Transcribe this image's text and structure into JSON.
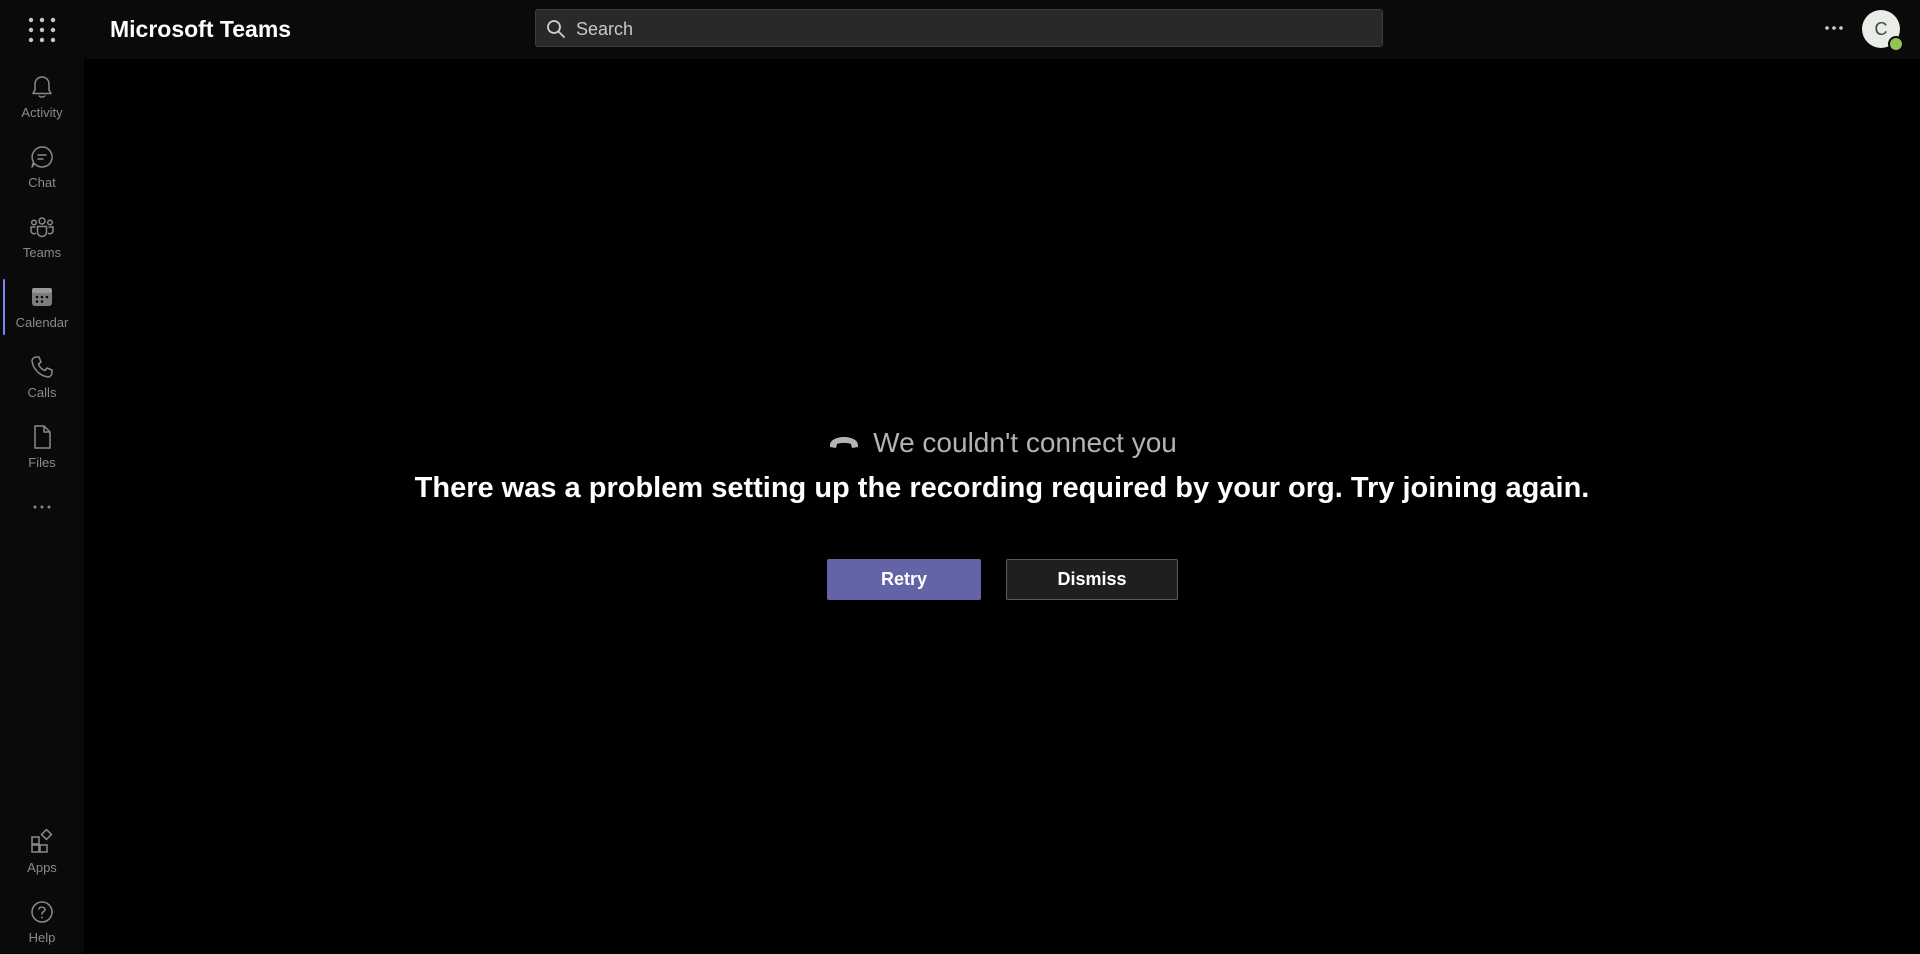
{
  "header": {
    "app_title": "Microsoft Teams",
    "search_placeholder": "Search",
    "avatar_initial": "C",
    "presence_color": "#92c353"
  },
  "rail": {
    "items": [
      {
        "label": "Activity",
        "icon": "bell-icon"
      },
      {
        "label": "Chat",
        "icon": "chat-icon"
      },
      {
        "label": "Teams",
        "icon": "teams-icon"
      },
      {
        "label": "Calendar",
        "icon": "calendar-icon",
        "active": true
      },
      {
        "label": "Calls",
        "icon": "phone-icon"
      },
      {
        "label": "Files",
        "icon": "file-icon"
      }
    ],
    "bottom": [
      {
        "label": "Apps",
        "icon": "apps-icon"
      },
      {
        "label": "Help",
        "icon": "help-icon"
      }
    ]
  },
  "error": {
    "title": "We couldn't connect you",
    "message": "There was a problem setting up the recording required by your org. Try joining again.",
    "retry_label": "Retry",
    "dismiss_label": "Dismiss"
  },
  "colors": {
    "accent": "#6264a7",
    "background": "#000000",
    "rail_background": "#0a0a0a"
  }
}
